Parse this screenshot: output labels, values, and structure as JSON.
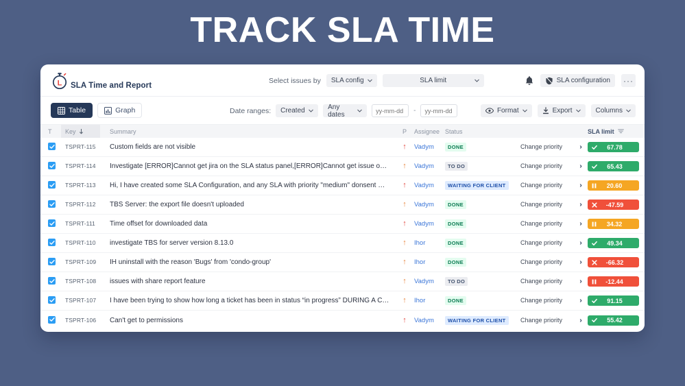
{
  "hero": {
    "title": "TRACK SLA TIME"
  },
  "colors": {
    "page_background": "#4e5f85",
    "brand_navy": "#253858",
    "brand_red": "#e8453c",
    "link_blue": "#3b76d8",
    "sla_green": "#2eab6a",
    "sla_orange": "#f5a623",
    "sla_red": "#f0503a"
  },
  "app": {
    "brand_name": "SLA Time and Report",
    "logo_icon": "stopwatch-icon",
    "topbar": {
      "select_issues_label": "Select issues by",
      "sla_config_select": "SLA config",
      "sla_limit_select": "SLA limit",
      "bell_icon": "bell-icon",
      "sla_configuration_button": "SLA configuration",
      "sla_configuration_icon": "shield-icon",
      "more_button": "···"
    },
    "toolbar": {
      "view_table": "Table",
      "view_table_icon": "grid-icon",
      "view_graph": "Graph",
      "view_graph_icon": "chart-icon",
      "date_ranges_label": "Date ranges:",
      "date_field_select": "Created",
      "date_range_select": "Any dates",
      "date_from_placeholder": "yy-mm-dd",
      "date_to_placeholder": "yy-mm-dd",
      "date_separator": "-",
      "format_button": "Format",
      "format_icon": "eye-icon",
      "export_button": "Export",
      "export_icon": "download-icon",
      "columns_button": "Columns"
    }
  },
  "table": {
    "headers": {
      "type": "T",
      "key": "Key",
      "key_sort_icon": "sort-down-icon",
      "summary": "Summary",
      "priority": "P",
      "assignee": "Assignee",
      "status": "Status",
      "action": "",
      "sla_limit": "SLA limit",
      "sla_filter_icon": "filter-icon"
    },
    "action_label": "Change priority",
    "chevron_icon": "chevron-right-icon",
    "rows": [
      {
        "checked": true,
        "key": "TSPRT-115",
        "summary": "Custom fields are not visible",
        "priority": "high",
        "assignee": "Vadym",
        "status": "DONE",
        "status_kind": "done",
        "sla_value": "67.78",
        "sla_kind": "ok",
        "sla_icon": "check-icon"
      },
      {
        "checked": true,
        "key": "TSPRT-114",
        "summary": "Investigate [ERROR]Cannot get jira on the SLA status panel,[ERROR]Cannot get issue on the SLA status panel",
        "priority": "medium",
        "assignee": "Vadym",
        "status": "TO DO",
        "status_kind": "todo",
        "sla_value": "65.43",
        "sla_kind": "ok",
        "sla_icon": "check-icon"
      },
      {
        "checked": true,
        "key": "TSPRT-113",
        "summary": "Hi, I have created some SLA Configuration, and any SLA with priority \"medium\" donsent work",
        "priority": "high",
        "assignee": "Vadym",
        "status": "WAITING FOR CLIENT",
        "status_kind": "wait",
        "sla_value": "20.60",
        "sla_kind": "paused",
        "sla_icon": "pause-icon"
      },
      {
        "checked": true,
        "key": "TSPRT-112",
        "summary": "TBS Server: the export file doesn't uploaded",
        "priority": "medium",
        "assignee": "Vadym",
        "status": "DONE",
        "status_kind": "done",
        "sla_value": "-47.59",
        "sla_kind": "breached",
        "sla_icon": "cross-icon"
      },
      {
        "checked": true,
        "key": "TSPRT-111",
        "summary": "Time offset for downloaded data",
        "priority": "high",
        "assignee": "Vadym",
        "status": "DONE",
        "status_kind": "done",
        "sla_value": "34.32",
        "sla_kind": "paused",
        "sla_icon": "pause-icon"
      },
      {
        "checked": true,
        "key": "TSPRT-110",
        "summary": "investigate TBS for server version 8.13.0",
        "priority": "medium",
        "assignee": "Ihor",
        "status": "DONE",
        "status_kind": "done",
        "sla_value": "49.34",
        "sla_kind": "ok",
        "sla_icon": "check-icon"
      },
      {
        "checked": true,
        "key": "TSPRT-109",
        "summary": "IH uninstall with the reason 'Bugs' from 'condo-group'",
        "priority": "medium",
        "assignee": "Ihor",
        "status": "DONE",
        "status_kind": "done",
        "sla_value": "-66.32",
        "sla_kind": "breached",
        "sla_icon": "cross-icon"
      },
      {
        "checked": true,
        "key": "TSPRT-108",
        "summary": "issues with share report feature",
        "priority": "medium",
        "assignee": "Vadym",
        "status": "TO DO",
        "status_kind": "todo",
        "sla_value": "-12.44",
        "sla_kind": "breached",
        "sla_icon": "pause-icon"
      },
      {
        "checked": true,
        "key": "TSPRT-107",
        "summary": "I have been trying to show how long a ticket has been in status “in progress” DURING A CERTAIN DAY",
        "priority": "medium",
        "assignee": "Ihor",
        "status": "DONE",
        "status_kind": "done",
        "sla_value": "91.15",
        "sla_kind": "ok",
        "sla_icon": "check-icon"
      },
      {
        "checked": true,
        "key": "TSPRT-106",
        "summary": "Can't get to permissions",
        "priority": "high",
        "assignee": "Vadym",
        "status": "WAITING FOR CLIENT",
        "status_kind": "wait",
        "sla_value": "55.42",
        "sla_kind": "ok",
        "sla_icon": "check-icon"
      }
    ]
  }
}
